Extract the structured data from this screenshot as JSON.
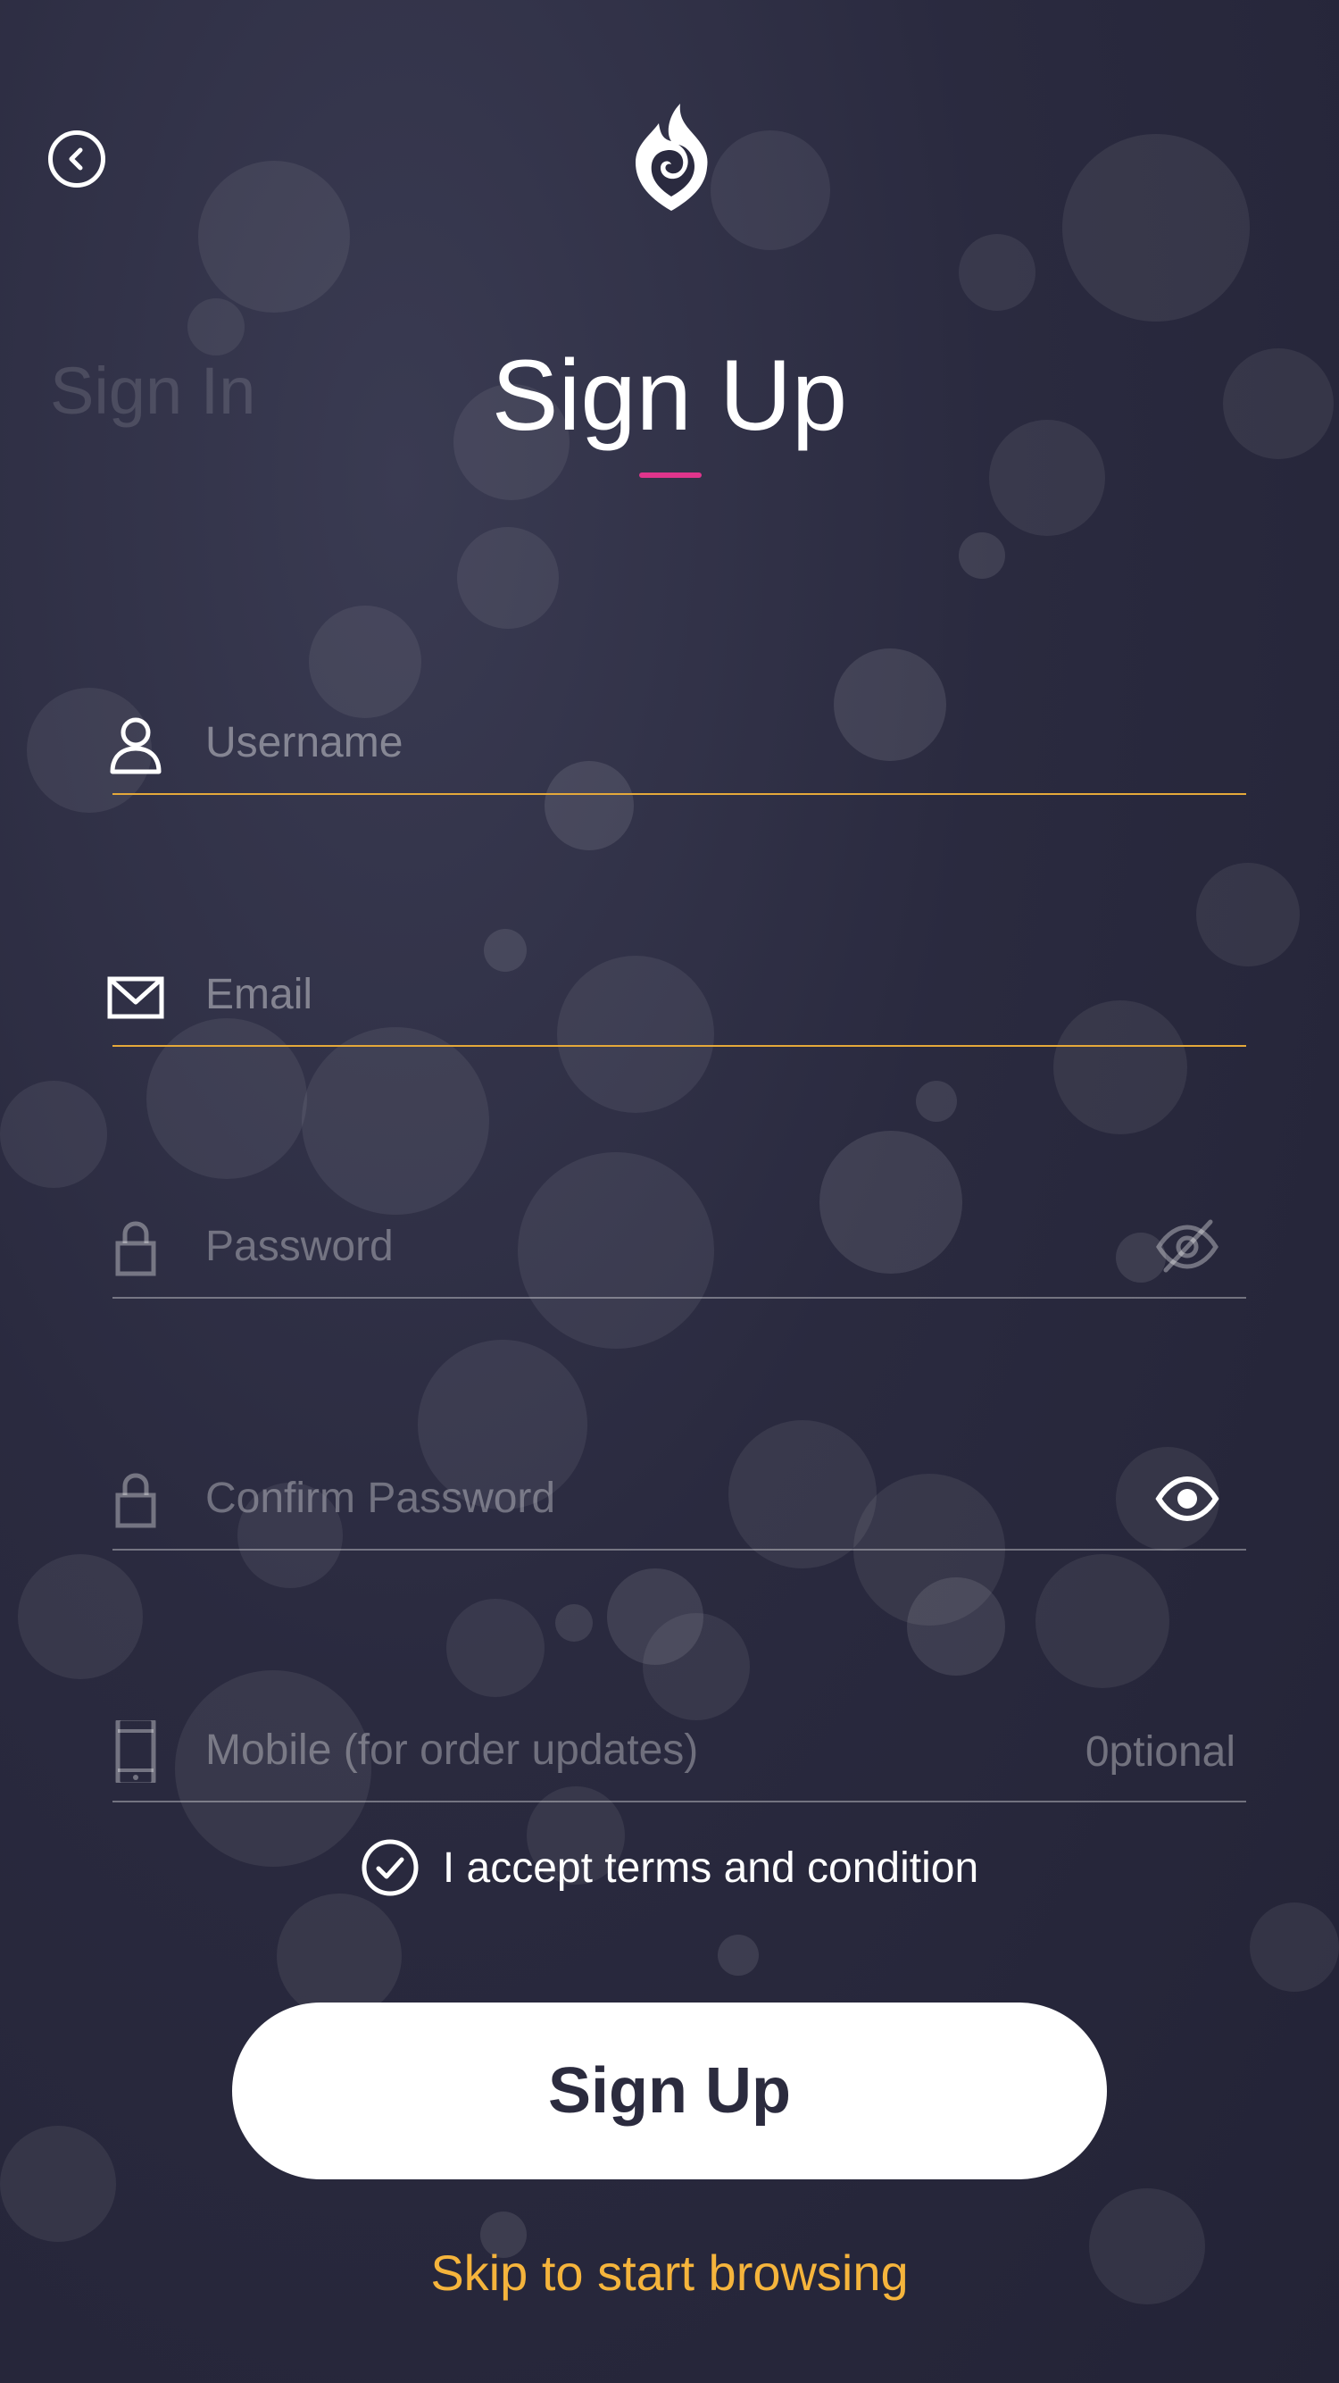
{
  "nav": {
    "back_icon": "chevron-left-circle-icon",
    "logo": "flame-logo"
  },
  "tabs": {
    "sign_in_label": "Sign In",
    "sign_up_label": "Sign Up"
  },
  "form": {
    "username": {
      "placeholder": "Username",
      "value": "",
      "icon": "user-icon"
    },
    "email": {
      "placeholder": "Email",
      "value": "",
      "icon": "envelope-icon"
    },
    "password": {
      "placeholder": "Password",
      "value": "",
      "icon": "lock-icon",
      "toggle_icon": "eye-off-icon"
    },
    "confirm_password": {
      "placeholder": "Confirm Password",
      "value": "",
      "icon": "lock-icon",
      "toggle_icon": "eye-icon"
    },
    "mobile": {
      "placeholder": "Mobile (for order updates)",
      "value": "",
      "icon": "phone-icon",
      "hint": "0ptional"
    }
  },
  "terms": {
    "label": "I accept terms and condition",
    "checked": true,
    "icon": "check-circle-icon"
  },
  "actions": {
    "submit_label": "Sign Up",
    "skip_label": "Skip to start browsing"
  },
  "colors": {
    "background": "#2a2a3f",
    "active_underline": "#e5a93a",
    "tab_indicator": "#e0358c",
    "skip_link": "#f5b43c",
    "button_text": "#2b2b3e"
  }
}
